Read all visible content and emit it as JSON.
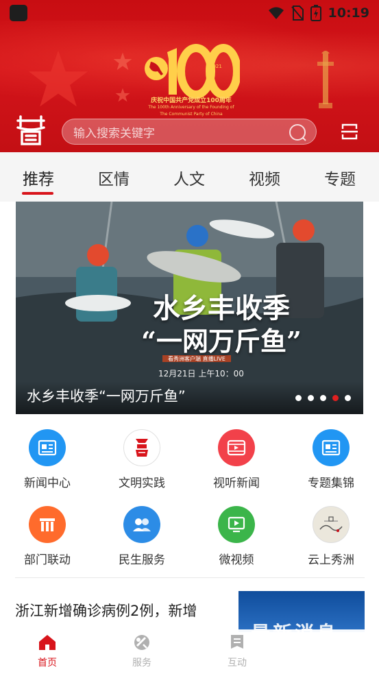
{
  "status_bar": {
    "time": "10:19"
  },
  "header": {
    "banner_number": "100",
    "banner_years": [
      "1921",
      "2021"
    ],
    "banner_caption_cn": "庆祝中国共产党成立100周年",
    "banner_caption_en_1": "The 100th Anniversary of the Founding of",
    "banner_caption_en_2": "The Communist Party of China",
    "logo_char": "秀",
    "search_placeholder": "输入搜索关键字"
  },
  "tabs": [
    {
      "label": "推荐",
      "active": true
    },
    {
      "label": "区情",
      "active": false
    },
    {
      "label": "人文",
      "active": false
    },
    {
      "label": "视频",
      "active": false
    },
    {
      "label": "专题",
      "active": false
    }
  ],
  "banner": {
    "title": "水乡丰收季“一网万斤鱼”",
    "overlay_line1": "水乡丰收季",
    "overlay_line2": "“一网万斤鱼”",
    "overlay_small": "看秀洲客户端 直播LIVE",
    "overlay_time": "12月21日 上午10：00",
    "dots_total": 5,
    "dots_active_index": 3
  },
  "grid": [
    {
      "label": "新闻中心",
      "icon": "newspaper-icon",
      "color": "#2196f3"
    },
    {
      "label": "文明实践",
      "icon": "civilization-logo-icon",
      "color": "#d8141b"
    },
    {
      "label": "视听新闻",
      "icon": "video-film-icon",
      "color": "#f2414a"
    },
    {
      "label": "专题集锦",
      "icon": "topics-icon",
      "color": "#2196f3"
    },
    {
      "label": "部门联动",
      "icon": "building-icon",
      "color": "#ff6b2c"
    },
    {
      "label": "民生服务",
      "icon": "people-icon",
      "color": "#2c8ce6"
    },
    {
      "label": "微视频",
      "icon": "play-screen-icon",
      "color": "#3bb54a"
    },
    {
      "label": "云上秀洲",
      "icon": "cloud-landscape-icon",
      "color": "#e9e6dc"
    }
  ],
  "news": {
    "title": "浙江新增确诊病例2例，新增",
    "thumb_text": "最新消息"
  },
  "bottom_nav": [
    {
      "label": "首页",
      "icon": "home-icon",
      "active": true
    },
    {
      "label": "服务",
      "icon": "service-icon",
      "active": false
    },
    {
      "label": "互动",
      "icon": "interact-icon",
      "active": false
    }
  ],
  "colors": {
    "brand_red": "#d8141b",
    "inactive_gray": "#b0b0b0"
  }
}
